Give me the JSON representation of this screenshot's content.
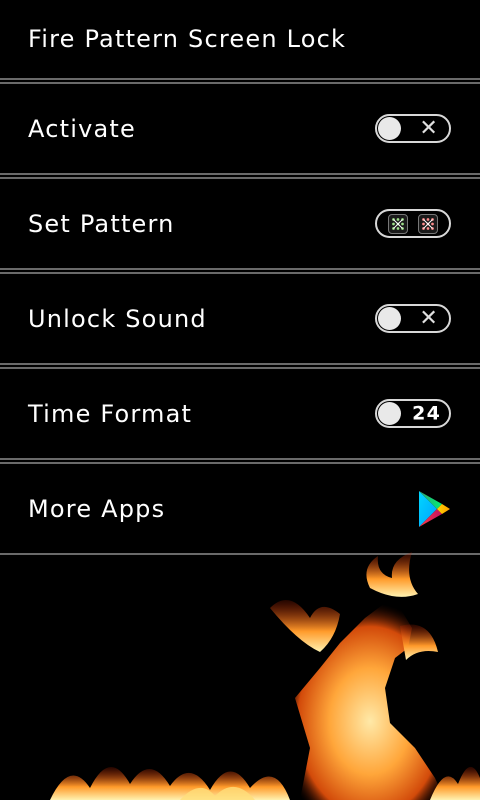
{
  "header": {
    "title": "Fire Pattern Screen Lock"
  },
  "settings": [
    {
      "label": "Activate",
      "control": "toggle-off",
      "glyph": "✕"
    },
    {
      "label": "Set Pattern",
      "control": "pattern"
    },
    {
      "label": "Unlock Sound",
      "control": "toggle-off",
      "glyph": "✕"
    },
    {
      "label": "Time Format",
      "control": "toggle-number",
      "glyph": "24"
    },
    {
      "label": "More Apps",
      "control": "play-store-icon"
    }
  ],
  "icons": {
    "toggle_knob": "circle",
    "off_mark": "x-mark-icon",
    "more_apps": "play-store-icon",
    "background_art": "fire-horse-image"
  },
  "colors": {
    "background": "#000000",
    "text": "#ffffff",
    "separator": "#6a6a6a",
    "toggle_border": "#d8d8d8"
  }
}
